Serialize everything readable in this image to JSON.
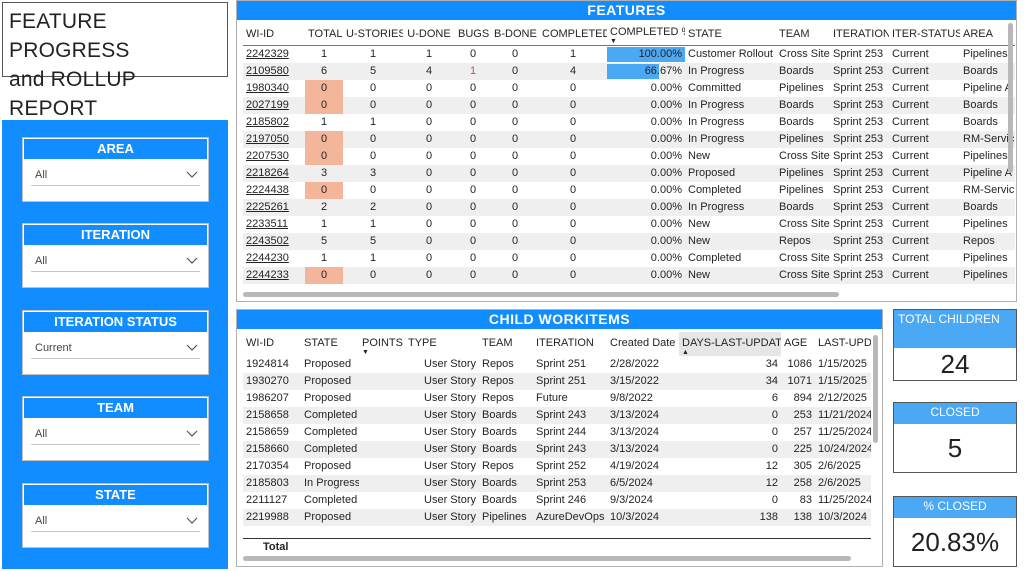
{
  "title": {
    "line1": "FEATURE PROGRESS",
    "line2": "and ROLLUP REPORT"
  },
  "filters": [
    {
      "header": "AREA",
      "value": "All"
    },
    {
      "header": "ITERATION",
      "value": "All"
    },
    {
      "header": "ITERATION STATUS",
      "value": "Current"
    },
    {
      "header": "TEAM",
      "value": "All"
    },
    {
      "header": "STATE",
      "value": "All"
    }
  ],
  "features": {
    "title": "FEATURES",
    "columns": [
      "WI-ID",
      "TOTAL",
      "U-STORIES",
      "U-DONE",
      "BUGS",
      "B-DONE",
      "COMPLETED",
      "COMPLETED %",
      "STATE",
      "TEAM",
      "ITERATION",
      "ITER-STATUS",
      "AREA"
    ],
    "rows": [
      {
        "id": "2242329",
        "total": "1",
        "ustories": "1",
        "udone": "1",
        "bugs": "0",
        "bdone": "0",
        "completed": "1",
        "pct": "100.00%",
        "pct_value": 1.0,
        "state": "Customer Rollout",
        "team": "Cross Site",
        "iteration": "Sprint 253",
        "iterstatus": "Current",
        "area": "Pipelines"
      },
      {
        "id": "2109580",
        "total": "6",
        "ustories": "5",
        "udone": "4",
        "bugs": "1",
        "bdone": "0",
        "completed": "4",
        "pct": "66.67%",
        "pct_value": 0.6667,
        "state": "In Progress",
        "team": "Boards",
        "iteration": "Sprint 253",
        "iterstatus": "Current",
        "area": "Boards"
      },
      {
        "id": "1980340",
        "total": "0",
        "ustories": "0",
        "udone": "0",
        "bugs": "0",
        "bdone": "0",
        "completed": "0",
        "pct": "0.00%",
        "pct_value": 0,
        "state": "Committed",
        "team": "Pipelines",
        "iteration": "Sprint 253",
        "iterstatus": "Current",
        "area": "Pipeline A"
      },
      {
        "id": "2027199",
        "total": "0",
        "ustories": "0",
        "udone": "0",
        "bugs": "0",
        "bdone": "0",
        "completed": "0",
        "pct": "0.00%",
        "pct_value": 0,
        "state": "In Progress",
        "team": "Boards",
        "iteration": "Sprint 253",
        "iterstatus": "Current",
        "area": "Boards"
      },
      {
        "id": "2185802",
        "total": "1",
        "ustories": "1",
        "udone": "0",
        "bugs": "0",
        "bdone": "0",
        "completed": "0",
        "pct": "0.00%",
        "pct_value": 0,
        "state": "In Progress",
        "team": "Boards",
        "iteration": "Sprint 253",
        "iterstatus": "Current",
        "area": "Boards"
      },
      {
        "id": "2197050",
        "total": "0",
        "ustories": "0",
        "udone": "0",
        "bugs": "0",
        "bdone": "0",
        "completed": "0",
        "pct": "0.00%",
        "pct_value": 0,
        "state": "In Progress",
        "team": "Pipelines",
        "iteration": "Sprint 253",
        "iterstatus": "Current",
        "area": "RM-Servic"
      },
      {
        "id": "2207530",
        "total": "0",
        "ustories": "0",
        "udone": "0",
        "bugs": "0",
        "bdone": "0",
        "completed": "0",
        "pct": "0.00%",
        "pct_value": 0,
        "state": "New",
        "team": "Cross Site",
        "iteration": "Sprint 253",
        "iterstatus": "Current",
        "area": "Pipelines"
      },
      {
        "id": "2218264",
        "total": "3",
        "ustories": "3",
        "udone": "0",
        "bugs": "0",
        "bdone": "0",
        "completed": "0",
        "pct": "0.00%",
        "pct_value": 0,
        "state": "Proposed",
        "team": "Pipelines",
        "iteration": "Sprint 253",
        "iterstatus": "Current",
        "area": "Pipeline A"
      },
      {
        "id": "2224438",
        "total": "0",
        "ustories": "0",
        "udone": "0",
        "bugs": "0",
        "bdone": "0",
        "completed": "0",
        "pct": "0.00%",
        "pct_value": 0,
        "state": "Completed",
        "team": "Pipelines",
        "iteration": "Sprint 253",
        "iterstatus": "Current",
        "area": "RM-Servic"
      },
      {
        "id": "2225261",
        "total": "2",
        "ustories": "2",
        "udone": "0",
        "bugs": "0",
        "bdone": "0",
        "completed": "0",
        "pct": "0.00%",
        "pct_value": 0,
        "state": "In Progress",
        "team": "Boards",
        "iteration": "Sprint 253",
        "iterstatus": "Current",
        "area": "Boards"
      },
      {
        "id": "2233511",
        "total": "1",
        "ustories": "1",
        "udone": "0",
        "bugs": "0",
        "bdone": "0",
        "completed": "0",
        "pct": "0.00%",
        "pct_value": 0,
        "state": "New",
        "team": "Cross Site",
        "iteration": "Sprint 253",
        "iterstatus": "Current",
        "area": "Pipelines"
      },
      {
        "id": "2243502",
        "total": "5",
        "ustories": "5",
        "udone": "0",
        "bugs": "0",
        "bdone": "0",
        "completed": "0",
        "pct": "0.00%",
        "pct_value": 0,
        "state": "New",
        "team": "Repos",
        "iteration": "Sprint 253",
        "iterstatus": "Current",
        "area": "Repos"
      },
      {
        "id": "2244230",
        "total": "1",
        "ustories": "1",
        "udone": "0",
        "bugs": "0",
        "bdone": "0",
        "completed": "0",
        "pct": "0.00%",
        "pct_value": 0,
        "state": "Completed",
        "team": "Cross Site",
        "iteration": "Sprint 253",
        "iterstatus": "Current",
        "area": "Pipelines"
      },
      {
        "id": "2244233",
        "total": "0",
        "ustories": "0",
        "udone": "0",
        "bugs": "0",
        "bdone": "0",
        "completed": "0",
        "pct": "0.00%",
        "pct_value": 0,
        "state": "New",
        "team": "Cross Site",
        "iteration": "Sprint 253",
        "iterstatus": "Current",
        "area": "Pipelines"
      }
    ],
    "highlight_color": "#F4B69A",
    "bar_color": "#4AA8F5"
  },
  "child": {
    "title": "CHILD WORKITEMS",
    "columns": [
      "WI-ID",
      "STATE",
      "POINTS",
      "TYPE",
      "TEAM",
      "ITERATION",
      "Created Date",
      "DAYS-LAST-UPDATE",
      "AGE",
      "LAST-UPDAT"
    ],
    "rows": [
      {
        "id": "1924814",
        "state": "Proposed",
        "points": "",
        "type": "User Story",
        "team": "Repos",
        "iteration": "Sprint 251",
        "created": "2/28/2022",
        "days": "34",
        "age": "1086",
        "last": "1/15/2025"
      },
      {
        "id": "1930270",
        "state": "Proposed",
        "points": "",
        "type": "User Story",
        "team": "Repos",
        "iteration": "Sprint 251",
        "created": "3/15/2022",
        "days": "34",
        "age": "1071",
        "last": "1/15/2025"
      },
      {
        "id": "1986207",
        "state": "Proposed",
        "points": "",
        "type": "User Story",
        "team": "Repos",
        "iteration": "Future",
        "created": "9/8/2022",
        "days": "6",
        "age": "894",
        "last": "2/12/2025"
      },
      {
        "id": "2158658",
        "state": "Completed",
        "points": "",
        "type": "User Story",
        "team": "Boards",
        "iteration": "Sprint 243",
        "created": "3/13/2024",
        "days": "0",
        "age": "253",
        "last": "11/21/2024"
      },
      {
        "id": "2158659",
        "state": "Completed",
        "points": "",
        "type": "User Story",
        "team": "Boards",
        "iteration": "Sprint 244",
        "created": "3/13/2024",
        "days": "0",
        "age": "257",
        "last": "11/25/2024"
      },
      {
        "id": "2158660",
        "state": "Completed",
        "points": "",
        "type": "User Story",
        "team": "Boards",
        "iteration": "Sprint 243",
        "created": "3/13/2024",
        "days": "0",
        "age": "225",
        "last": "10/24/2024"
      },
      {
        "id": "2170354",
        "state": "Proposed",
        "points": "",
        "type": "User Story",
        "team": "Repos",
        "iteration": "Sprint 252",
        "created": "4/19/2024",
        "days": "12",
        "age": "305",
        "last": "2/6/2025"
      },
      {
        "id": "2185803",
        "state": "In Progress",
        "points": "",
        "type": "User Story",
        "team": "Boards",
        "iteration": "Sprint 253",
        "created": "6/5/2024",
        "days": "12",
        "age": "258",
        "last": "2/6/2025"
      },
      {
        "id": "2211127",
        "state": "Completed",
        "points": "",
        "type": "User Story",
        "team": "Boards",
        "iteration": "Sprint 246",
        "created": "9/3/2024",
        "days": "0",
        "age": "83",
        "last": "11/25/2024"
      },
      {
        "id": "2219988",
        "state": "Proposed",
        "points": "",
        "type": "User Story",
        "team": "Pipelines",
        "iteration": "AzureDevOps",
        "created": "10/3/2024",
        "days": "138",
        "age": "138",
        "last": "10/3/2024"
      }
    ],
    "total_label": "Total"
  },
  "kpis": [
    {
      "label": "TOTAL CHILDREN",
      "value": "24"
    },
    {
      "label": "CLOSED",
      "value": "5"
    },
    {
      "label": "% CLOSED",
      "value": "20.83%"
    }
  ],
  "colors": {
    "accent": "#118DFF",
    "card_header": "#4AA8F5"
  }
}
